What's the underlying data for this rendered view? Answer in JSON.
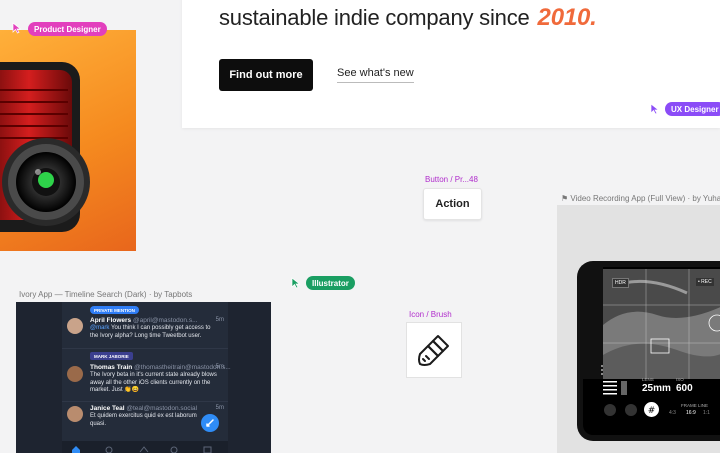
{
  "hero": {
    "headline": "sustainable indie company since",
    "year": "2010.",
    "primary_button": "Find out more",
    "secondary_link": "See what's new"
  },
  "cursors": {
    "product_designer": "Product Designer",
    "ux_designer": "UX Designer",
    "illustrator": "Illustrator"
  },
  "components": {
    "button_label": "Button / Pr...48",
    "button_text": "Action",
    "icon_label": "Icon / Brush"
  },
  "frames": {
    "ivory_label": "Ivory App — Timeline Search (Dark) · by Tapbots",
    "video_label": "Video Recording App (Full View) · by Yuhan"
  },
  "ivory": {
    "tweets": [
      {
        "badge": "PRIVATE MENTION",
        "name": "April Flowers",
        "handle": "@april@mastodon.s...",
        "time": "5m",
        "mention": "@mark",
        "body": " You think I can possibly get access to the Ivory alpha? Long time Tweetbot user."
      },
      {
        "badge": "MARK JABORIE",
        "name": "Thomas Train",
        "handle": "@thomastheitrain@mastodon.s...",
        "time": "5m",
        "mention": "",
        "body": "The Ivory beta in it's current state already blows away all the other iOS clients currently on the market. Just 👏😄"
      },
      {
        "badge": "",
        "name": "Janice Teal",
        "handle": "@teal@mastodon.social",
        "time": "5m",
        "mention": "",
        "body": "Et quidem exercitus quid ex est laborum quasi."
      }
    ]
  },
  "camera": {
    "hdr": "HDR",
    "rec": "• REC",
    "lens_label": "LENS",
    "lens_value": "25mm",
    "iso_label": "ISO",
    "iso_value": "600",
    "frame_label": "FRAME LINE",
    "ratio_1": "4:3",
    "ratio_2": "16:9",
    "ratio_3": "1:1"
  },
  "colors": {
    "product_designer": "#e23fbd",
    "ux_designer": "#8b4cf7",
    "illustrator": "#1a9e62",
    "accent_year": "#f06a3b"
  }
}
